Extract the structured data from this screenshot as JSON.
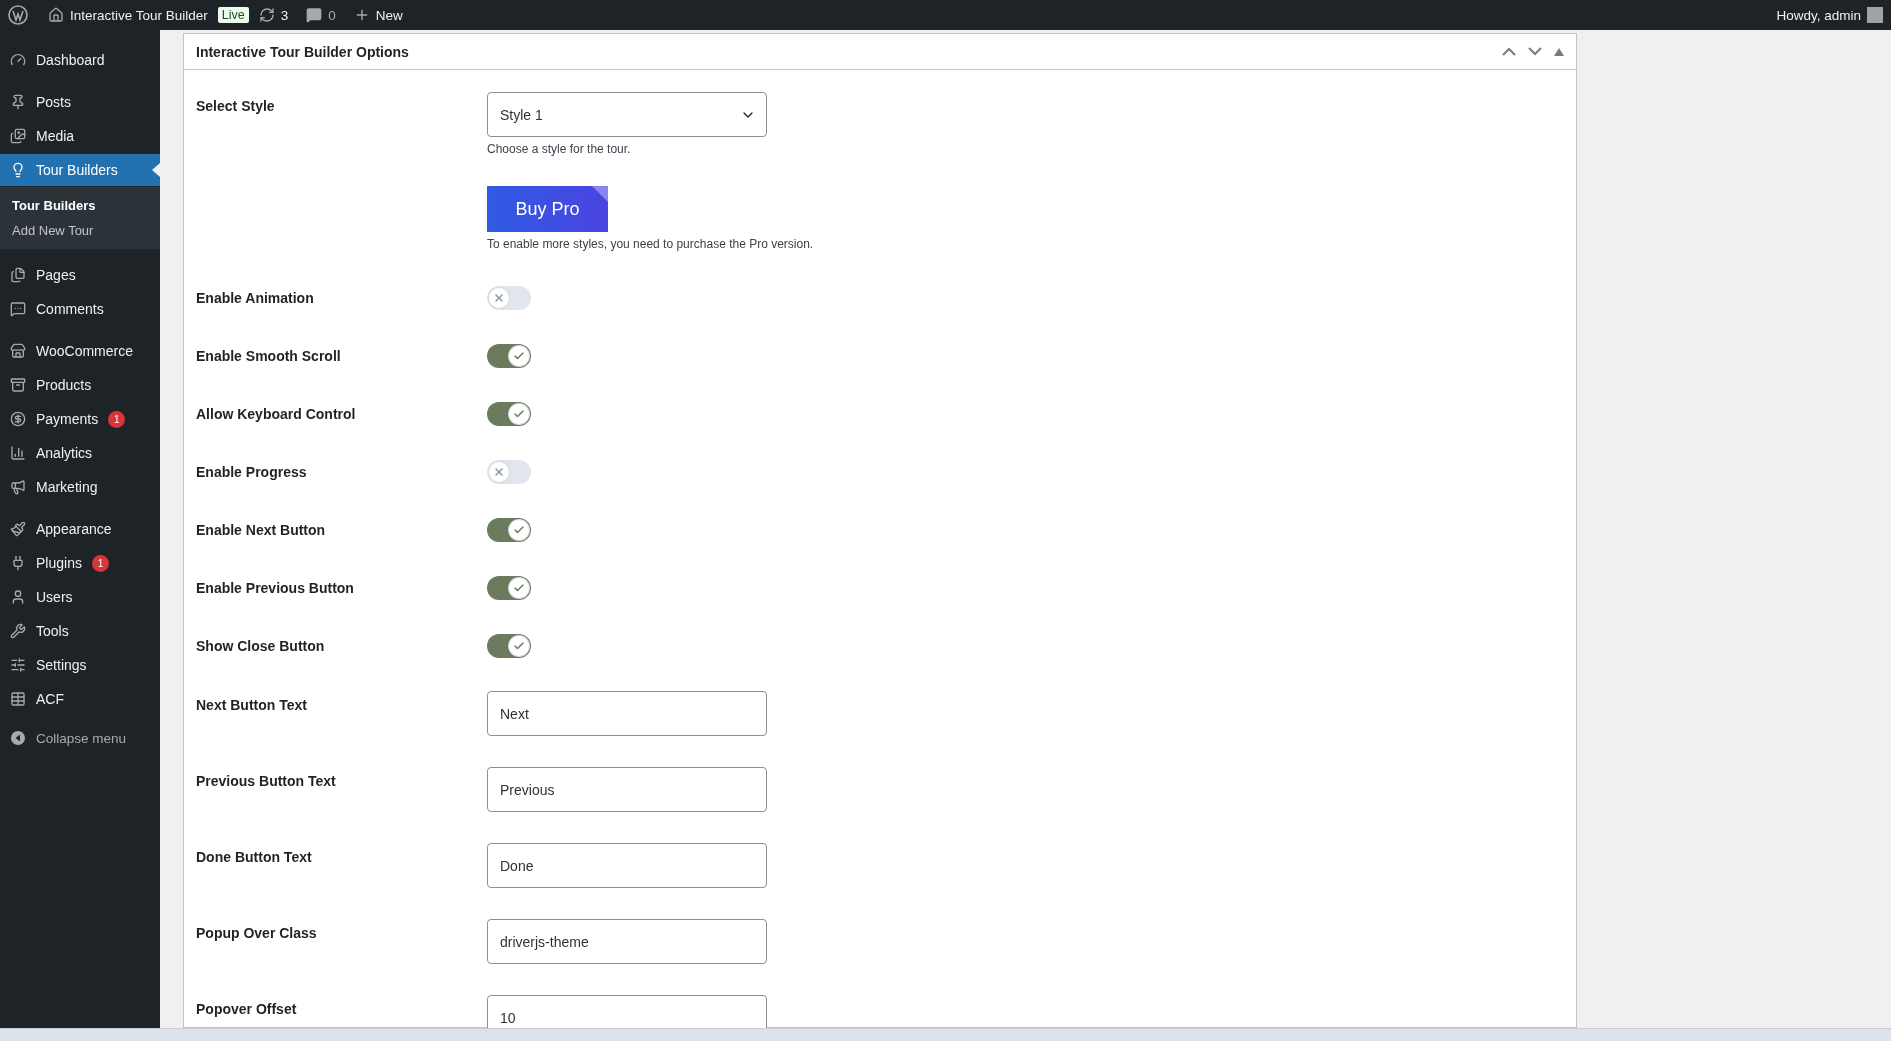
{
  "admin_bar": {
    "site_name": "Interactive Tour Builder",
    "badge": "Live",
    "updates": "3",
    "comments": "0",
    "new": "New",
    "greeting": "Howdy, admin"
  },
  "sidebar": {
    "items": [
      {
        "label": "Dashboard",
        "selected": false
      },
      {
        "label": "Posts",
        "selected": false
      },
      {
        "label": "Media",
        "selected": false
      },
      {
        "label": "Tour Builders",
        "selected": true,
        "children": [
          {
            "label": "Tour Builders",
            "selected": true
          },
          {
            "label": "Add New Tour",
            "selected": false
          }
        ]
      },
      {
        "label": "Pages",
        "selected": false
      },
      {
        "label": "Comments",
        "selected": false
      },
      {
        "label": "WooCommerce",
        "selected": false
      },
      {
        "label": "Products",
        "selected": false
      },
      {
        "label": "Payments",
        "selected": false,
        "badge": "1"
      },
      {
        "label": "Analytics",
        "selected": false
      },
      {
        "label": "Marketing",
        "selected": false
      },
      {
        "label": "Appearance",
        "selected": false
      },
      {
        "label": "Plugins",
        "selected": false,
        "badge": "1"
      },
      {
        "label": "Users",
        "selected": false
      },
      {
        "label": "Tools",
        "selected": false
      },
      {
        "label": "Settings",
        "selected": false
      },
      {
        "label": "ACF",
        "selected": false
      }
    ],
    "collapse": "Collapse menu"
  },
  "panel": {
    "title": "Interactive Tour Builder Options",
    "fields": [
      {
        "kind": "select",
        "label": "Select Style",
        "value": "Style 1",
        "help": "Choose a style for the tour."
      },
      {
        "kind": "button",
        "label": "Buy Pro",
        "help": "To enable more styles, you need to purchase the Pro version."
      },
      {
        "kind": "toggle",
        "label": "Enable Animation",
        "on": false
      },
      {
        "kind": "toggle",
        "label": "Enable Smooth Scroll",
        "on": true
      },
      {
        "kind": "toggle",
        "label": "Allow Keyboard Control",
        "on": true
      },
      {
        "kind": "toggle",
        "label": "Enable Progress",
        "on": false
      },
      {
        "kind": "toggle",
        "label": "Enable Next Button",
        "on": true
      },
      {
        "kind": "toggle",
        "label": "Enable Previous Button",
        "on": true
      },
      {
        "kind": "toggle",
        "label": "Show Close Button",
        "on": true
      },
      {
        "kind": "text",
        "label": "Next Button Text",
        "value": "Next"
      },
      {
        "kind": "text",
        "label": "Previous Button Text",
        "value": "Previous"
      },
      {
        "kind": "text",
        "label": "Done Button Text",
        "value": "Done"
      },
      {
        "kind": "text",
        "label": "Popup Over Class",
        "value": "driverjs-theme"
      },
      {
        "kind": "text",
        "label": "Popover Offset",
        "value": "10"
      }
    ]
  }
}
